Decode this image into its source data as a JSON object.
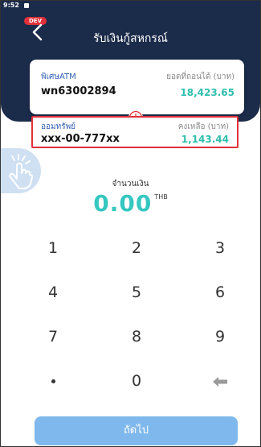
{
  "status": {
    "time": "9:52"
  },
  "header": {
    "dev_badge": "DEV",
    "title": "รับเงินกู้สหกรณ์"
  },
  "source_account": {
    "type_label": "พิเศษATM",
    "number": "wn63002894",
    "balance_label": "ยอดที่ถอนได้ (บาท)",
    "balance": "18,423.65"
  },
  "target_account": {
    "type_label": "ออมทรัพย์",
    "number": "xxx-00-777xx",
    "balance_label": "คงเหลือ (บาท)",
    "balance": "1,143.44"
  },
  "amount": {
    "label": "จำนวนเงิน",
    "value": "0.00",
    "currency": "THB"
  },
  "keypad": {
    "k1": "1",
    "k2": "2",
    "k3": "3",
    "k4": "4",
    "k5": "5",
    "k6": "6",
    "k7": "7",
    "k8": "8",
    "k9": "9",
    "k0": "0"
  },
  "next_button": {
    "label": "ถัดไป"
  },
  "colors": {
    "header": "#1b2b4a",
    "accent": "#35c7c0",
    "highlight": "#e0313a",
    "button": "#7fb8ec"
  }
}
